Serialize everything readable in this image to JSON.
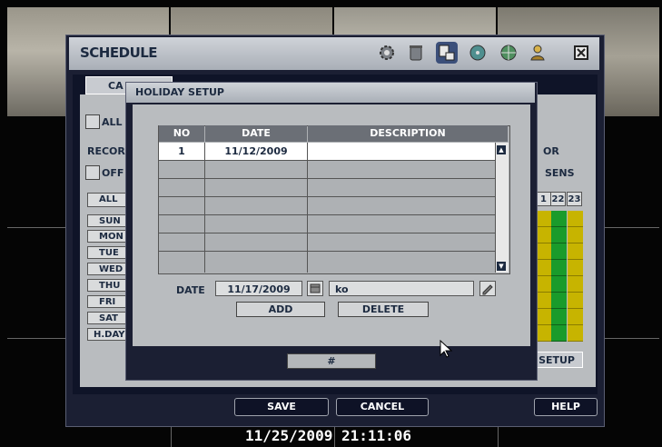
{
  "window": {
    "title": "SCHEDULE"
  },
  "toolbar_icons": [
    "gear-icon",
    "trash-icon",
    "schedule-icon",
    "disc-icon",
    "network-icon",
    "user-icon",
    "close-icon"
  ],
  "tabs": {
    "camera": "CA"
  },
  "schedule_panel": {
    "all_label": "ALL",
    "record_label": "RECOR",
    "off_label": "OFF",
    "all_button": "ALL",
    "days": [
      "SUN",
      "MON",
      "TUE",
      "WED",
      "THU",
      "FRI",
      "SAT",
      "H.DAY"
    ],
    "right_label_1": "OR",
    "right_label_2": "SENS",
    "hours": [
      "1",
      "22",
      "23"
    ],
    "setup_button": "SETUP"
  },
  "holiday_dialog": {
    "title": "HOLIDAY SETUP",
    "columns": [
      "NO",
      "DATE",
      "DESCRIPTION"
    ],
    "rows": [
      {
        "no": "1",
        "date": "11/12/2009",
        "description": ""
      }
    ],
    "date_label": "DATE",
    "date_value": "11/17/2009",
    "description_value": "ko",
    "add_button": "ADD",
    "delete_button": "DELETE",
    "bottom_button": "#"
  },
  "footer": {
    "save": "SAVE",
    "cancel": "CANCEL",
    "help": "HELP"
  },
  "timestamp": "11/25/2009 21:11:06",
  "colors": {
    "grid_green": "#1a9b2b",
    "grid_yellow": "#c7b400",
    "accent_dark": "#1b1f33"
  }
}
